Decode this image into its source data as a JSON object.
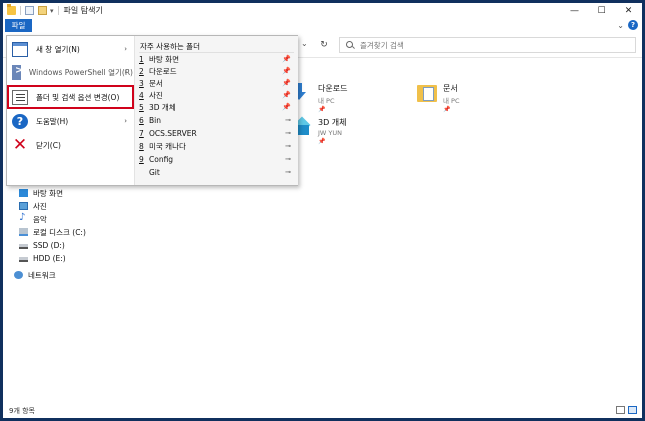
{
  "window": {
    "title": "파일 탐색기",
    "controls": {
      "minimize": "—",
      "maximize": "☐",
      "close": "✕"
    }
  },
  "ribbon": {
    "file_tab": "파일",
    "collapse_chevron": "⌄",
    "help": "?"
  },
  "address": {
    "dropdown": "⌄",
    "refresh": "↻",
    "search_placeholder": "즐겨찾기 검색"
  },
  "file_menu": {
    "items": [
      {
        "label": "새 창 열기(N)",
        "has_submenu": true,
        "icon": "new-window-icon"
      },
      {
        "label": "Windows PowerShell 열기(R)",
        "has_submenu": true,
        "icon": "powershell-icon"
      },
      {
        "label": "폴더 및 검색 옵션 변경(O)",
        "has_submenu": false,
        "icon": "folder-options-icon",
        "highlighted": true
      },
      {
        "label": "도움말(H)",
        "has_submenu": true,
        "icon": "help-icon"
      },
      {
        "label": "닫기(C)",
        "has_submenu": false,
        "icon": "close-icon"
      }
    ],
    "submenu_arrow": "›",
    "frequent_header": "자주 사용하는 폴더",
    "frequent": [
      {
        "num": "1",
        "label": "바탕 화면",
        "pin": "📌"
      },
      {
        "num": "2",
        "label": "다운로드",
        "pin": "📌"
      },
      {
        "num": "3",
        "label": "문서",
        "pin": "📌"
      },
      {
        "num": "4",
        "label": "사진",
        "pin": "📌"
      },
      {
        "num": "5",
        "label": "3D 개체",
        "pin": "📌"
      },
      {
        "num": "6",
        "label": "Bin",
        "pin": "⊸"
      },
      {
        "num": "7",
        "label": "OCS.SERVER",
        "pin": "⊸"
      },
      {
        "num": "8",
        "label": "미국 캐나다",
        "pin": "⊸"
      },
      {
        "num": "9",
        "label": "Config",
        "pin": "⊸"
      },
      {
        "num": "",
        "label": "Git",
        "pin": "⊸"
      }
    ]
  },
  "quick_access": {
    "items": [
      {
        "name": "다운로드",
        "sub": "내 PC",
        "pin": "📌",
        "icon": "downloads-folder-icon"
      },
      {
        "name": "문서",
        "sub": "내 PC",
        "pin": "📌",
        "icon": "documents-folder-icon"
      },
      {
        "name": "3D 개체",
        "sub": "JW YUN",
        "pin": "📌",
        "icon": "3d-objects-folder-icon"
      }
    ]
  },
  "nav": {
    "items": [
      {
        "label": "바탕 화면",
        "icon": "desktop-icon"
      },
      {
        "label": "사진",
        "icon": "pictures-icon"
      },
      {
        "label": "음악",
        "icon": "music-icon"
      },
      {
        "label": "로컬 디스크 (C:)",
        "icon": "local-disk-icon"
      },
      {
        "label": "SSD (D:)",
        "icon": "drive-icon"
      },
      {
        "label": "HDD (E:)",
        "icon": "drive-icon"
      },
      {
        "label": "네트워크",
        "icon": "network-icon"
      }
    ]
  },
  "status": {
    "count": "9개 항목"
  }
}
